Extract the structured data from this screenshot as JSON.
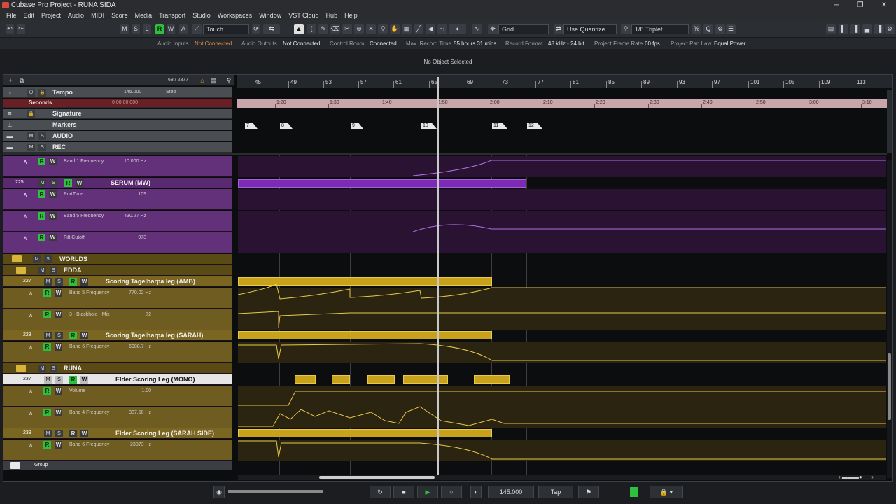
{
  "window": {
    "title": "Cubase Pro Project - RUNA SIDA",
    "controls": [
      "─",
      "❐",
      "✕"
    ]
  },
  "menu": [
    "File",
    "Edit",
    "Project",
    "Audio",
    "MIDI",
    "Score",
    "Media",
    "Transport",
    "Studio",
    "Workspaces",
    "Window",
    "VST Cloud",
    "Hub",
    "Help"
  ],
  "toolbar": {
    "m": "M",
    "s": "S",
    "l": "L",
    "r": "R",
    "w": "W",
    "a": "A",
    "automation_mode": "Touch",
    "snap_type": "Grid",
    "quantize_mode": "Use Quantize",
    "quantize_value": "1/8  Triplet"
  },
  "status": [
    {
      "label": "Audio Inputs",
      "value": "Not Connected",
      "warn": true
    },
    {
      "label": "Audio Outputs",
      "value": "Not Connected",
      "warn": false
    },
    {
      "label": "Control Room",
      "value": "Connected",
      "warn": false
    },
    {
      "label": "Max. Record Time",
      "value": "55 hours 31 mins",
      "warn": false
    },
    {
      "label": "Record Format",
      "value": "48 kHz - 24 bit",
      "warn": false
    },
    {
      "label": "Project Frame Rate",
      "value": "60 fps",
      "warn": false
    },
    {
      "label": "Project Pan Law",
      "value": "Equal Power",
      "warn": false
    }
  ],
  "info_line": "No Object Selected",
  "track_header": {
    "count": "68 / 2877"
  },
  "ruler": {
    "bars": [
      "45",
      "49",
      "53",
      "57",
      "61",
      "65",
      "69",
      "73",
      "77",
      "81",
      "85",
      "89",
      "93",
      "97",
      "101",
      "105",
      "109",
      "113"
    ],
    "times": [
      "1:20",
      "1:30",
      "1:40",
      "1:50",
      "2:00",
      "2:10",
      "2:20",
      "2:30",
      "2:40",
      "2:50",
      "3:00",
      "3:10"
    ]
  },
  "global_tracks": {
    "tempo": {
      "name": "Tempo",
      "value": "145.000",
      "mode": "Step"
    },
    "seconds": {
      "name": "Seconds",
      "value": "0:00:00.000"
    },
    "signature": {
      "name": "Signature"
    },
    "markers": {
      "name": "Markers",
      "items": [
        "7",
        "8",
        "9",
        "10",
        "11",
        "12"
      ]
    },
    "audio": {
      "name": "AUDIO"
    },
    "rec": {
      "name": "REC"
    }
  },
  "tracks": {
    "serum_band1": {
      "param": "Band 1 Frequency",
      "value": "10.000 Hz"
    },
    "serum": {
      "num": "225",
      "name": "SERUM (MW)"
    },
    "serum_port": {
      "param": "PortTime",
      "value": "109"
    },
    "serum_band5": {
      "param": "Band 5 Frequency",
      "value": "430.27 Hz"
    },
    "serum_filt": {
      "param": "Filt Cutoff",
      "value": "973"
    },
    "worlds": {
      "name": "WORLDS"
    },
    "edda": {
      "name": "EDDA"
    },
    "t227": {
      "num": "227",
      "name": "Scoring Tagelharpa leg (AMB)"
    },
    "t227_band5": {
      "param": "Band 5 Frequency",
      "value": "770.02 Hz"
    },
    "t227_bh": {
      "param": "3 - Blackhole - Mix",
      "value": "72"
    },
    "t228": {
      "num": "228",
      "name": "Scoring Tagelharpa leg (SARAH)"
    },
    "t228_band6": {
      "param": "Band 6 Frequency",
      "value": "6088.7 Hz"
    },
    "runa": {
      "name": "RUNA"
    },
    "t237": {
      "num": "237",
      "name": "Elder Scoring Leg (MONO)"
    },
    "t237_vol": {
      "param": "Volume",
      "value": "1.00"
    },
    "t237_band4": {
      "param": "Band 4 Frequency",
      "value": "337.50 Hz"
    },
    "t239": {
      "num": "239",
      "name": "Elder Scoring Leg (SARAH SIDE)"
    },
    "t239_band6": {
      "param": "Band 6 Frequency",
      "value": "23873 Hz"
    },
    "group": {
      "name": "Group"
    }
  },
  "transport": {
    "tempo": "145.000",
    "tap": "Tap"
  },
  "colors": {
    "accent_green": "#2fbf3f",
    "purple": "#7d2bb6",
    "olive": "#c9a21c",
    "warn": "#e6893a"
  }
}
